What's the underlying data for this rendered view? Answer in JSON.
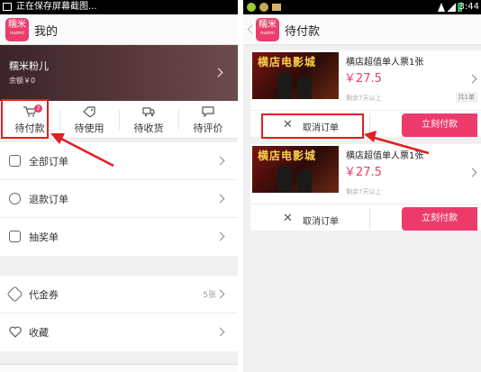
{
  "left": {
    "status_text": "正在保存屏幕截图...",
    "logo": {
      "cn": "糯米",
      "en": "nuomi"
    },
    "title": "我的",
    "profile": {
      "name": "糯米粉儿",
      "balance": "余额￥0"
    },
    "quick_tabs": [
      {
        "label": "待付款",
        "badge": "2",
        "icon": "cart-icon"
      },
      {
        "label": "待使用",
        "icon": "tag-icon"
      },
      {
        "label": "待收货",
        "icon": "truck-icon"
      },
      {
        "label": "待评价",
        "icon": "comment-icon"
      }
    ],
    "menu_group1": [
      {
        "label": "全部订单",
        "icon": "order-list-icon"
      },
      {
        "label": "退款订单",
        "icon": "refund-icon"
      },
      {
        "label": "抽奖单",
        "icon": "gift-icon"
      }
    ],
    "menu_group2": [
      {
        "label": "代金券",
        "count": "5张",
        "icon": "voucher-icon"
      },
      {
        "label": "收藏",
        "icon": "heart-icon"
      }
    ]
  },
  "right": {
    "status_time": "3:44",
    "title": "待付款",
    "orders": [
      {
        "poster_text": "横店电影城",
        "name": "横店超值单人票1张",
        "price": "￥27.5",
        "remaining": "剩余7天以上",
        "qty": "共1单",
        "cancel": "取消订单",
        "pay": "立刻付款"
      },
      {
        "poster_text": "横店电影城",
        "name": "横店超值单人票1张",
        "price": "￥27.5",
        "remaining": "剩余7天以上",
        "qty": "",
        "cancel": "取消订单",
        "pay": "立刻付款"
      }
    ]
  },
  "colors": {
    "brand": "#ea3e6b",
    "annotation": "#e02020"
  }
}
